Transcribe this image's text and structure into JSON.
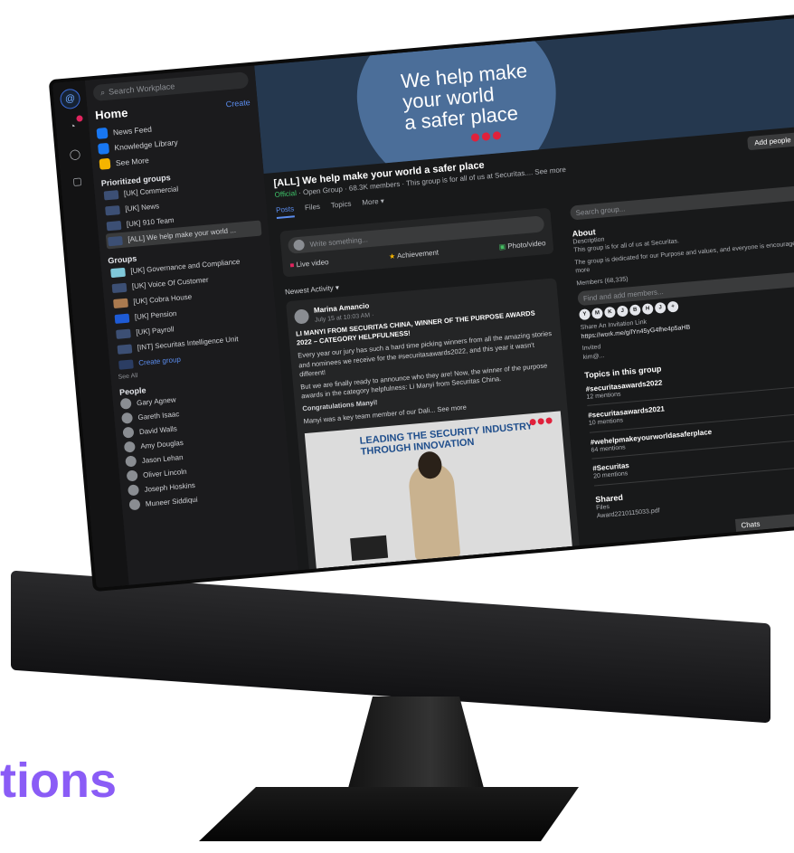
{
  "headline": "tions",
  "sidebar": {
    "search_placeholder": "Search Workplace",
    "home_title": "Home",
    "create_label": "Create",
    "nav": [
      {
        "label": "News Feed",
        "color": "#1877f2"
      },
      {
        "label": "Knowledge Library",
        "color": "#1877f2"
      },
      {
        "label": "See More",
        "color": "#f5b400"
      }
    ],
    "prioritized_title": "Prioritized groups",
    "prioritized": [
      "[UK] Commercial",
      "[UK] News",
      "[UK] 910 Team",
      "[ALL] We help make your world ..."
    ],
    "groups_title": "Groups",
    "groups": [
      "[UK] Governance and Compliance",
      "[UK] Voice Of Customer",
      "[UK] Cobra House",
      "[UK] Pension",
      "[UK] Payroll",
      "[INT] Securitas Intelligence Unit",
      "Create group"
    ],
    "see_all": "See All",
    "people_title": "People",
    "people": [
      "Gary Agnew",
      "Gareth Isaac",
      "David Walls",
      "Amy Douglas",
      "Jason Lehan",
      "Oliver Lincoln",
      "Joseph Hoskins",
      "Muneer Siddiqui"
    ]
  },
  "banner": {
    "line1": "We help make",
    "line2": "your world",
    "line3": "a safer place"
  },
  "group": {
    "title": "[ALL] We help make your world a safer place",
    "official": "Official",
    "subtitle": "· Open Group · 68.3K members · This group is for all of us at Securitas.... See more",
    "add_people": "Add people",
    "more": "···",
    "tabs": [
      "Posts",
      "Files",
      "Topics",
      "More ▾"
    ]
  },
  "composer": {
    "placeholder": "Write something...",
    "live": "Live video",
    "achievement": "Achievement",
    "photo": "Photo/video"
  },
  "newest_activity": "Newest Activity ▾",
  "post": {
    "author": "Marina Amancio",
    "time": "July 15 at 10:03 AM · ",
    "headline": "LI MANYI FROM SECURITAS CHINA, WINNER OF THE PURPOSE AWARDS 2022 – CATEGORY HELPFULNESS!",
    "body1": "Every year our jury has such a hard time picking winners from all the amazing stories and nominees we receive for the #securitasawards2022, and this year it wasn't different!",
    "body2": "But we are finally ready to announce who they are! Now, the winner of the purpose awards in the category helpfulness: Li Manyi from Securitas China.",
    "congrats": "Congratulations Manyi!",
    "body3": "Manyi was a key team member of our Dali... See more",
    "photo_line1": "LEADING THE SECURITY INDUSTRY",
    "photo_line2": "THROUGH INNOVATION"
  },
  "right": {
    "search_placeholder": "Search group...",
    "about_title": "About",
    "desc_label": "Description",
    "desc1": "This group is for all of us at Securitas.",
    "desc2": "The group is dedicated for our Purpose and values, and everyone is encouraged... See more",
    "members_label": "Members (68,335)",
    "find_members": "Find and add members...",
    "member_initials": [
      "Y",
      "M",
      "K",
      "J",
      "B",
      "H",
      "J",
      "+"
    ],
    "invite_label": "Share An Invitation Link",
    "invite_link": "https://work.me/g/lYn45yG4fhe4p5aHB",
    "invited_label": "Invited",
    "invited_name": "kim@...",
    "topics_title": "Topics in this group",
    "topics": [
      {
        "tag": "#securitasawards2022",
        "count": "12 mentions"
      },
      {
        "tag": "#securitasawards2021",
        "count": "10 mentions"
      },
      {
        "tag": "#wehelpmakeyourworldasaferplace",
        "count": "64 mentions"
      },
      {
        "tag": "#Securitas",
        "count": "20 mentions"
      }
    ],
    "shared_title": "Shared",
    "files_label": "Files",
    "file_name": "Award2210115033.pdf",
    "chats_label": "Chats"
  }
}
